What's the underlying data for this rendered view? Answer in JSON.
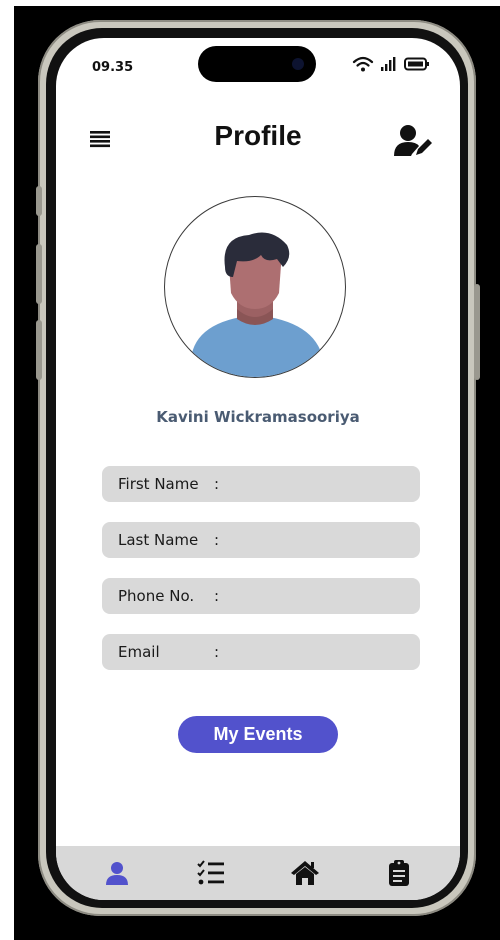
{
  "status_bar": {
    "time": "09.35",
    "icons": [
      "wifi-icon",
      "signal-icon",
      "battery-icon"
    ]
  },
  "header": {
    "title": "Profile",
    "menu_icon": "hamburger-icon",
    "edit_icon": "user-edit-icon"
  },
  "profile": {
    "avatar_icon": "person-avatar-illustration",
    "name": "Kavini Wickramasooriya"
  },
  "fields": [
    {
      "label": "First Name",
      "colon": ":"
    },
    {
      "label": "Last Name",
      "colon": ":"
    },
    {
      "label": "Phone No.",
      "colon": ":"
    },
    {
      "label": "Email",
      "colon": ":"
    }
  ],
  "actions": {
    "my_events_label": "My Events"
  },
  "bottom_nav": {
    "items": [
      {
        "icon": "profile-icon",
        "active": true
      },
      {
        "icon": "task-list-icon",
        "active": false
      },
      {
        "icon": "home-icon",
        "active": false
      },
      {
        "icon": "clipboard-icon",
        "active": false
      }
    ]
  },
  "colors": {
    "accent": "#5252cc",
    "name_text": "#4a5b72",
    "field_bg": "#d9d9d9",
    "nav_bg": "#d8d8d8",
    "active_nav": "#5252cc"
  }
}
